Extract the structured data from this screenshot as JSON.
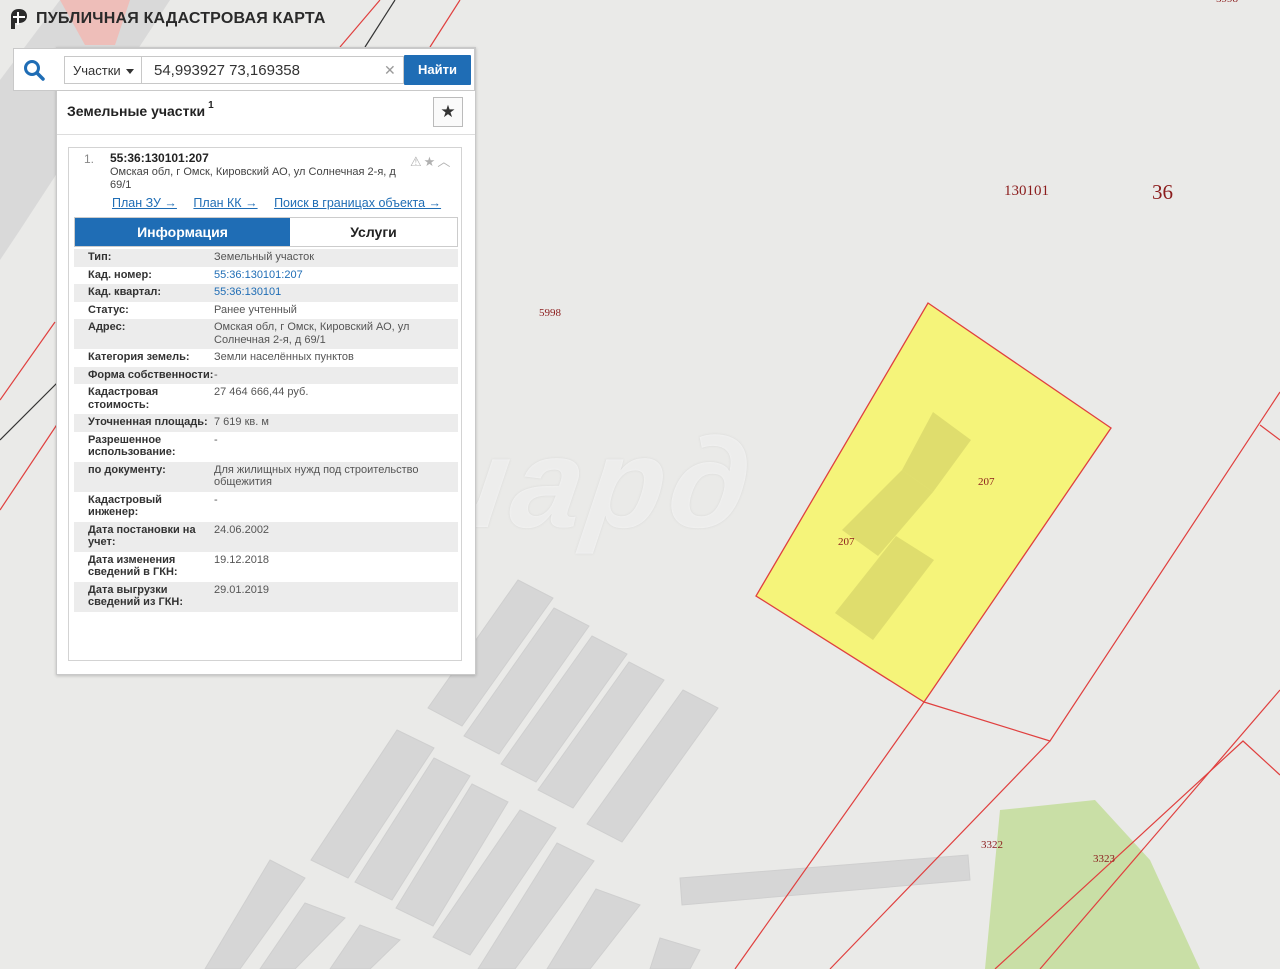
{
  "app": {
    "title": "ПУБЛИЧНАЯ КАДАСТРОВАЯ КАРТА"
  },
  "search": {
    "type_selected": "Участки",
    "query": "54,993927 73,169358",
    "find_label": "Найти"
  },
  "results": {
    "title": "Земельные участки",
    "count": "1"
  },
  "card": {
    "index": "1.",
    "cadastral_number": "55:36:130101:207",
    "address": "Омская обл, г Омск, Кировский АО, ул Солнечная 2-я, д 69/1",
    "links": [
      "План ЗУ →",
      "План КК →",
      "Поиск в границах объекта →"
    ],
    "tabs": [
      "Информация",
      "Услуги"
    ],
    "active_tab": "Информация",
    "rows": [
      {
        "label": "Тип:",
        "value": "Земельный участок"
      },
      {
        "label": "Кад. номер:",
        "value": "55:36:130101:207",
        "link": true
      },
      {
        "label": "Кад. квартал:",
        "value": "55:36:130101",
        "link": true
      },
      {
        "label": "Статус:",
        "value": "Ранее учтенный"
      },
      {
        "label": "Адрес:",
        "value": "Омская обл, г Омск, Кировский АО, ул Солнечная 2-я, д 69/1"
      },
      {
        "label": "Категория земель:",
        "value": "Земли населённых пунктов"
      },
      {
        "label": "Форма собственности:",
        "value": "-"
      },
      {
        "label": "Кадастровая стоимость:",
        "value": "27 464 666,44 руб."
      },
      {
        "label": "Уточненная площадь:",
        "value": "7 619 кв. м"
      },
      {
        "label": "Разрешенное использование:",
        "value": "-"
      },
      {
        "label": "по документу:",
        "value": "Для жилищных нужд под строительство общежития"
      },
      {
        "label": "Кадастровый инженер:",
        "value": "-"
      },
      {
        "label": "Дата постановки на учет:",
        "value": "24.06.2002"
      },
      {
        "label": "Дата изменения сведений в ГКН:",
        "value": "19.12.2018"
      },
      {
        "label": "Дата выгрузки сведений из ГКН:",
        "value": "29.01.2019"
      }
    ]
  },
  "map": {
    "labels": [
      "130101",
      "36",
      "5998",
      "5998",
      "207",
      "207",
      "3322",
      "3323"
    ],
    "watermark": "миард"
  },
  "colors": {
    "accent": "#1f6db5",
    "parcel_fill": "#f5f47a",
    "boundary": "#e0403f",
    "green_area": "#c9dfa6"
  }
}
